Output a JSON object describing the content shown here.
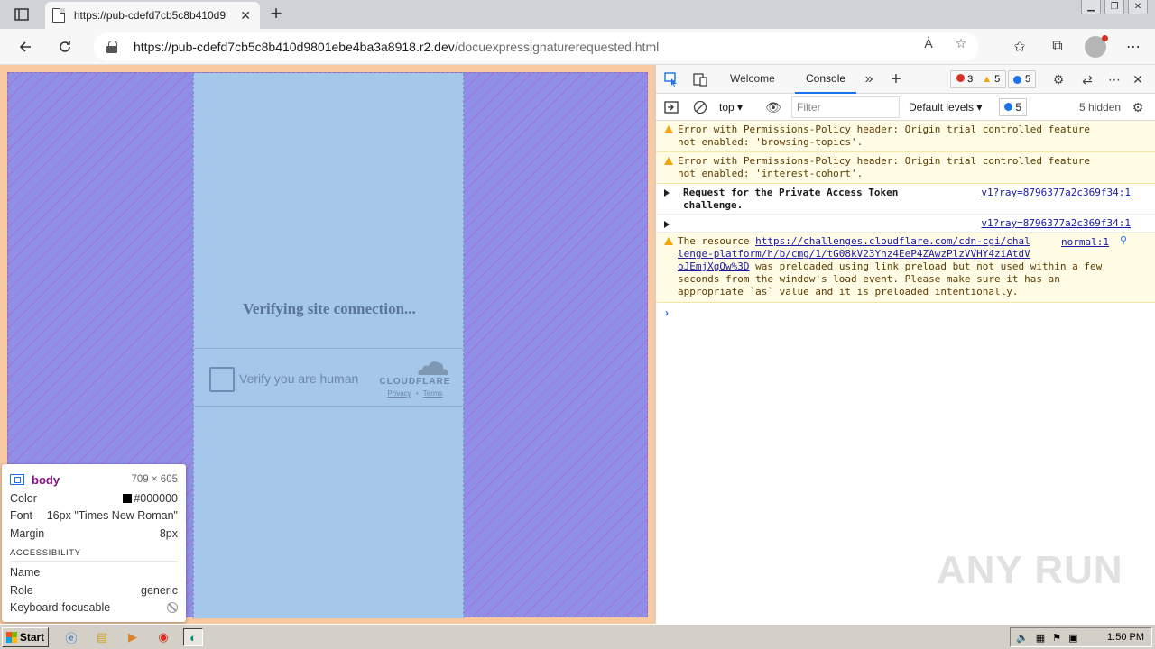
{
  "browser": {
    "tab_title": "https://pub-cdefd7cb5c8b410d9",
    "url_main": "https://pub-cdefd7cb5c8b410d9801ebe4ba3a8918.r2.dev",
    "url_path": "/docuexpressignaturerequested.html"
  },
  "page": {
    "verifying_text": "Verifying site connection...",
    "verify_label": "Verify you are human",
    "brand": "CLOUDFLARE",
    "privacy": "Privacy",
    "separator": "•",
    "terms": "Terms"
  },
  "inspect": {
    "tag": "body",
    "dims": "709 × 605",
    "color_label": "Color",
    "color_value": "#000000",
    "font_label": "Font",
    "font_value": "16px \"Times New Roman\"",
    "margin_label": "Margin",
    "margin_value": "8px",
    "section": "ACCESSIBILITY",
    "name_label": "Name",
    "role_label": "Role",
    "role_value": "generic",
    "kbd_label": "Keyboard-focusable"
  },
  "devtools": {
    "tabs": [
      "Welcome",
      "Console"
    ],
    "errors": "3",
    "warnings": "5",
    "info": "5",
    "context": "top",
    "filter_placeholder": "Filter",
    "levels": "Default levels",
    "issues": "5",
    "hidden": "5 hidden",
    "messages": [
      {
        "type": "warn",
        "text": "Error with Permissions-Policy header: Origin trial controlled feature\nnot enabled: 'browsing-topics'."
      },
      {
        "type": "warn",
        "text": "Error with Permissions-Policy header: Origin trial controlled feature\nnot enabled: 'interest-cohort'."
      },
      {
        "type": "group",
        "text": "Request for the Private Access Token\nchallenge.",
        "source": "v1?ray=8796377a2c369f34:1"
      },
      {
        "type": "group",
        "text": "",
        "source": "v1?ray=8796377a2c369f34:1"
      },
      {
        "type": "warn",
        "prefix": "The resource ",
        "link": "https://challenges.cloudflare.com/cdn-cgi/chal\nlenge-platform/h/b/cmg/1/tG08kV23Ynz4EeP4ZAwzPlzVVHY4ziAtdV\noJEmjXgQw%3D",
        "suffix": " was preloaded using link preload but not used within a few\nseconds from the window's load event. Please make sure it has an\nappropriate `as` value and it is preloaded intentionally.",
        "source": "normal:1"
      }
    ]
  },
  "taskbar": {
    "start": "Start",
    "time": "1:50 PM"
  },
  "watermark": "ANY RUN",
  "colors": {
    "body_highlight": "#8f8fe8",
    "content_highlight": "#a4c7ea",
    "margin_highlight": "#f8c8a0",
    "accent": "#1a73e8"
  }
}
